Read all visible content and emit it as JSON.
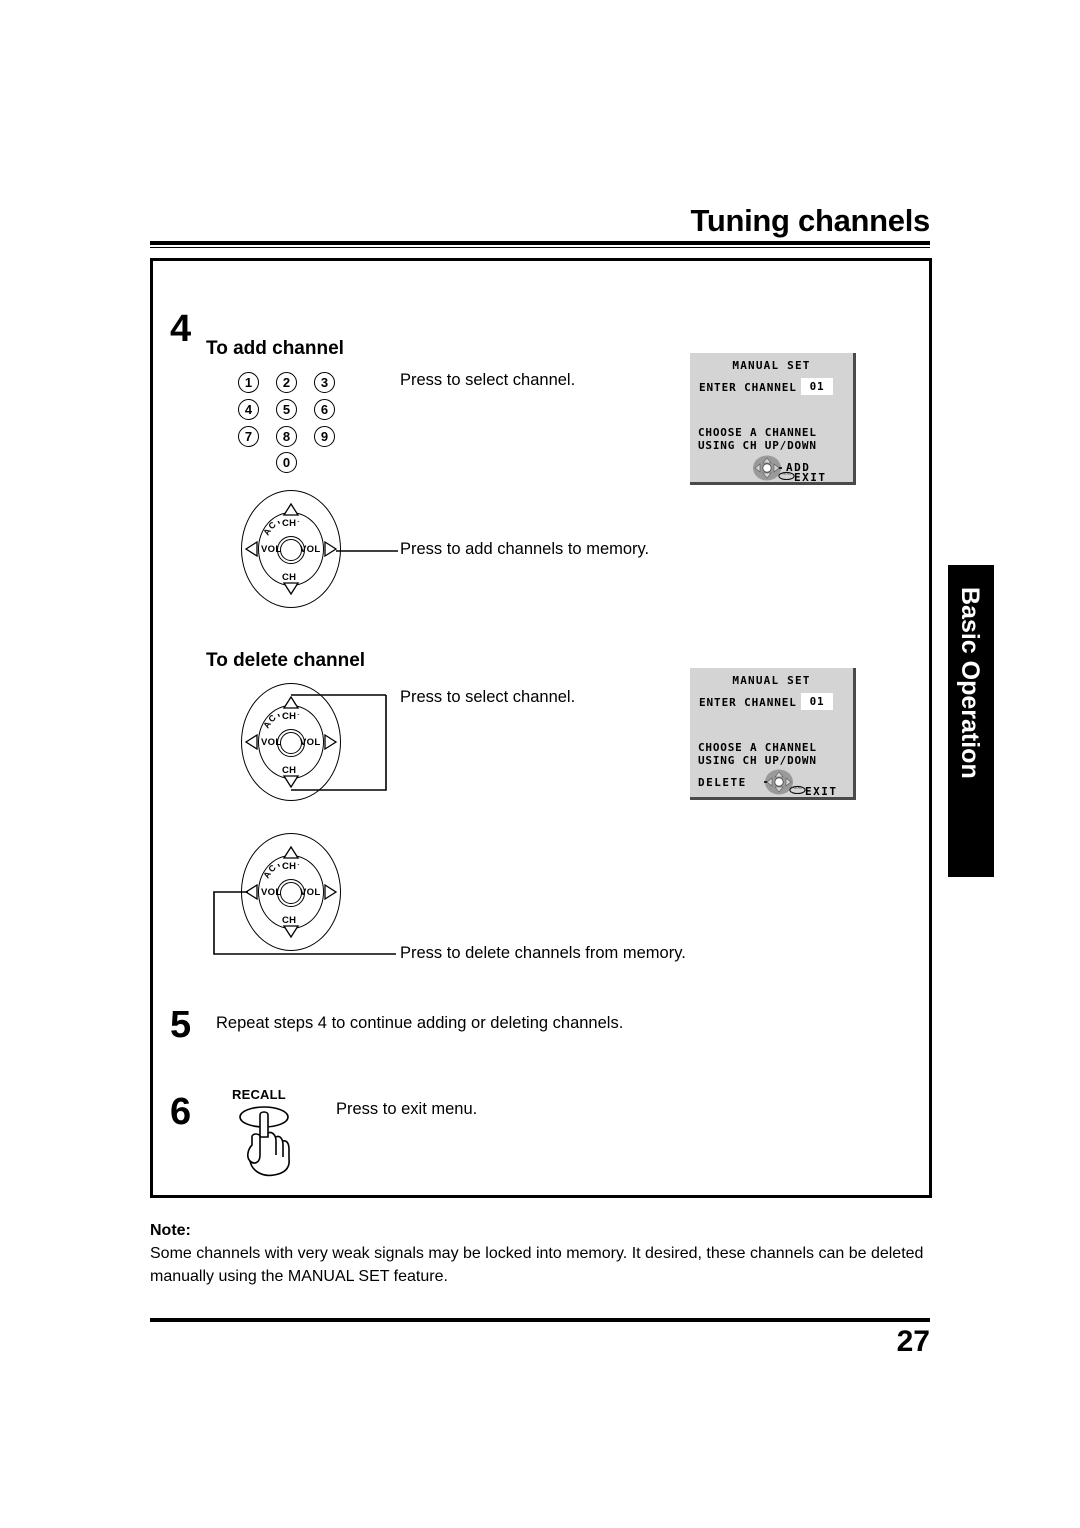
{
  "header": {
    "title": "Tuning channels"
  },
  "side_tab": {
    "label": "Basic Operation"
  },
  "steps": [
    {
      "number": "4",
      "sections": [
        {
          "heading": "To add channel",
          "captions": [
            "Press to select channel.",
            "Press to add channels to memory."
          ]
        },
        {
          "heading": "To delete channel",
          "captions": [
            "Press to select channel.",
            "Press to delete channels from memory."
          ]
        }
      ]
    },
    {
      "number": "5",
      "text": "Repeat steps 4 to continue adding or deleting channels."
    },
    {
      "number": "6",
      "button_label": "RECALL",
      "text": "Press to exit menu."
    }
  ],
  "keypad": {
    "keys": [
      "1",
      "2",
      "3",
      "4",
      "5",
      "6",
      "7",
      "8",
      "9",
      "0"
    ]
  },
  "control_pad": {
    "ch_up_label": "CH",
    "ch_down_label": "CH",
    "vol_left_label": "VOL",
    "vol_right_label": "VOL",
    "action_label": "ACTION"
  },
  "osd_panels": [
    {
      "title": "MANUAL SET",
      "field_label": "ENTER CHANNEL :",
      "field_value": "01",
      "hint_line1": "CHOOSE A CHANNEL",
      "hint_line2": "USING CH UP/DOWN",
      "action_label": "ADD",
      "exit_label": "EXIT",
      "background": "#d4d4d4"
    },
    {
      "title": "MANUAL SET",
      "field_label": "ENTER CHANNEL :",
      "field_value": "01",
      "hint_line1": "CHOOSE A CHANNEL",
      "hint_line2": "USING CH UP/DOWN",
      "action_label": "DELETE",
      "exit_label": "EXIT",
      "background": "#d4d4d4"
    }
  ],
  "note": {
    "heading": "Note:",
    "body": "Some channels with very weak signals may be locked into memory. It desired, these channels can be deleted manually using the MANUAL SET feature."
  },
  "footer": {
    "page_number": "27"
  }
}
